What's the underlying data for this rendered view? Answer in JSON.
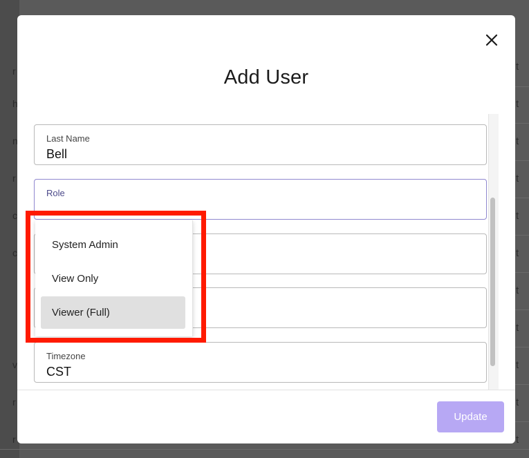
{
  "background": {
    "row_glyph": "t",
    "left_glyphs": [
      "r",
      "h",
      "n",
      "r",
      "c",
      "c",
      "v",
      "r",
      "r"
    ]
  },
  "modal": {
    "title": "Add User",
    "fields": {
      "last_name": {
        "label": "Last Name",
        "value": "Bell"
      },
      "role": {
        "label": "Role",
        "value": ""
      },
      "timezone": {
        "label": "Timezone",
        "value": "CST"
      }
    },
    "role_options": [
      "System Admin",
      "View Only",
      "Viewer (Full)"
    ],
    "role_selected_option": "Viewer (Full)",
    "update_label": "Update"
  },
  "colors": {
    "accent_button": "#b7a8f4",
    "focus_border": "#8f87cf",
    "highlight_box": "#ff1a00"
  },
  "icons": {
    "close": "close-icon"
  }
}
